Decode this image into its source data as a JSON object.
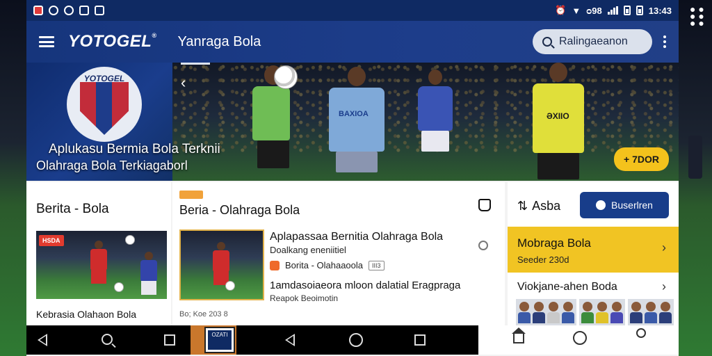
{
  "statusbar": {
    "time": "13:43",
    "signal_text": "ᴑ98"
  },
  "appbar": {
    "logo": "YOTOGEL",
    "logo_mark": "®",
    "title": "Yanraga Bola",
    "search_placeholder": "Ralingaeanon"
  },
  "hero": {
    "crest_text": "YOTOGEL",
    "title": "Aplukasu Bermia Bola Terknii",
    "subtitle": "Olahraga Bola Terkiagaborl",
    "player2_jersey": "BAXIOA",
    "player4_jersey": "ƏXIIO",
    "action_chip": "+ 7DOR"
  },
  "left_column": {
    "title": "Berita - Bola",
    "thumb_badge": "HSDA",
    "caption": "Kebrasia Olahaon Bola"
  },
  "middle_column": {
    "title": "Beria - Olahraga Bola",
    "headline": "Aplapassaa Bernitia Olahraga Bola",
    "headline_sub": "Doalkang eneniitiel",
    "source": "Borita - Olahaaoola",
    "source_badge": "III3",
    "headline2": "1amdasoiaeora mloon dalatial Eragpraga",
    "headline2_sub": "Reapok Beoimotin",
    "meta": "Bo; Koe 203 8"
  },
  "right_column": {
    "header_label": "Asba",
    "primary_button": "Buserlren",
    "highlight_title": "Mobraga Bola",
    "highlight_sub": "Seeder 230d",
    "item2_title": "Viokjane-ahen Boda"
  },
  "navbar": {
    "app_thumb_label": "OZATI"
  },
  "colors": {
    "brand_navy": "#16357c",
    "accent_yellow": "#f1c423",
    "button_navy": "#183d8a"
  },
  "icons": [
    "menu-icon",
    "search-icon",
    "more-icon",
    "chevron-left-icon",
    "bell-icon",
    "share-icon",
    "user-add-icon",
    "chevron-right-icon",
    "back-icon",
    "home-icon",
    "recents-icon",
    "profile-icon"
  ]
}
